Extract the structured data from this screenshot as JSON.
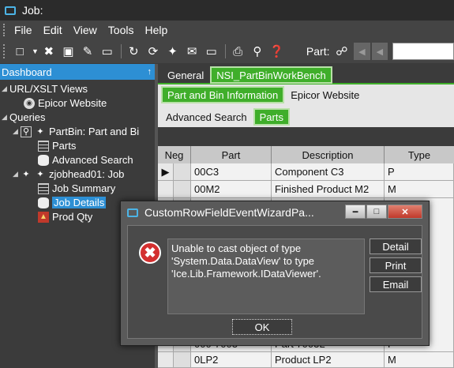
{
  "window": {
    "title": "Job:"
  },
  "menu": [
    "File",
    "Edit",
    "View",
    "Tools",
    "Help"
  ],
  "toolbar": {
    "icons": [
      "new-icon",
      "dropdown-icon",
      "delete-icon",
      "save-icon",
      "clear-icon",
      "undo-icon",
      "refresh-icon",
      "wizard-icon",
      "attachment-icon",
      "print-icon",
      "preview-icon",
      "help-icon"
    ],
    "part_label": "Part:",
    "part_value": ""
  },
  "dashboard": {
    "header": "Dashboard",
    "pin_glyph": "↑",
    "tree": {
      "url_views": "URL/XSLT Views",
      "epicor_website": "Epicor Website",
      "queries": "Queries",
      "partbin": "PartBin: Part and Bi",
      "parts": "Parts",
      "advanced_search": "Advanced Search",
      "zjobhead": "zjobhead01: Job",
      "job_summary": "Job Summary",
      "job_details": "Job Details",
      "prod_qty": "Prod Qty"
    }
  },
  "tabs": {
    "row1": [
      "General",
      "NSI_PartBinWorkBench"
    ],
    "row2": [
      "Part and Bin Information",
      "Epicor Website"
    ],
    "row3": [
      "Advanced Search",
      "Parts"
    ]
  },
  "grid": {
    "columns": [
      "Neg",
      "Part",
      "Description",
      "Type"
    ],
    "rows": [
      {
        "part": "00C3",
        "description": "Component C3",
        "type": "P"
      },
      {
        "part": "00M2",
        "description": "Finished Product M2",
        "type": "M"
      }
    ],
    "bottom_rows": [
      {
        "part": "000-7003",
        "description": "Part 7003L",
        "type": "P"
      },
      {
        "part": "0LP2",
        "description": "Product LP2",
        "type": "M"
      }
    ]
  },
  "dialog": {
    "title": "CustomRowFieldEventWizardPa...",
    "message": "Unable to cast object of type\n'System.Data.DataView' to type\n'Ice.Lib.Framework.IDataViewer'.",
    "buttons": {
      "detail": "Detail",
      "print": "Print",
      "email": "Email",
      "ok": "OK"
    },
    "error_glyph": "✖"
  },
  "colors": {
    "accent": "#2d8fd4",
    "active_tab": "#3fae2a",
    "error": "#d32f2f"
  }
}
